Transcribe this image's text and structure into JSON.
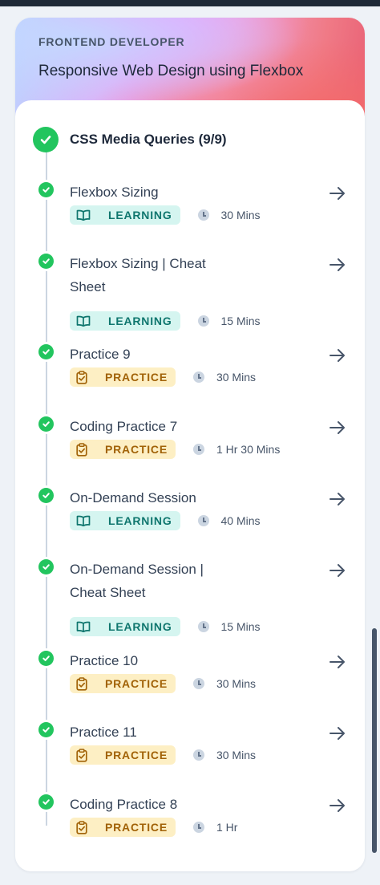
{
  "course": {
    "eyebrow": "FRONTEND DEVELOPER",
    "title": "Responsive Web Design using Flexbox"
  },
  "section": {
    "title": "CSS Media Queries (9/9)",
    "status": "completed"
  },
  "items": [
    {
      "title": "Flexbox Sizing",
      "type": "LEARNING",
      "duration": "30 Mins",
      "completed": true
    },
    {
      "title": "Flexbox Sizing | Cheat Sheet",
      "type": "LEARNING",
      "duration": "15 Mins",
      "completed": true
    },
    {
      "title": "Practice 9",
      "type": "PRACTICE",
      "duration": "30 Mins",
      "completed": true
    },
    {
      "title": "Coding Practice 7",
      "type": "PRACTICE",
      "duration": "1 Hr 30 Mins",
      "completed": true
    },
    {
      "title": "On-Demand Session",
      "type": "LEARNING",
      "duration": "40 Mins",
      "completed": true
    },
    {
      "title": "On-Demand Session | Cheat Sheet",
      "type": "LEARNING",
      "duration": "15 Mins",
      "completed": true
    },
    {
      "title": "Practice 10",
      "type": "PRACTICE",
      "duration": "30 Mins",
      "completed": true
    },
    {
      "title": "Practice 11",
      "type": "PRACTICE",
      "duration": "30 Mins",
      "completed": true
    },
    {
      "title": "Coding Practice 8",
      "type": "PRACTICE",
      "duration": "1 Hr",
      "completed": true
    }
  ],
  "icons": {
    "completed": "check-circle-icon",
    "open": "arrow-right-icon",
    "learning": "book-open-icon",
    "practice": "clipboard-check-icon",
    "duration": "clock-icon"
  },
  "colors": {
    "success": "#22c55e",
    "learning_bg": "#d5f5f0",
    "learning_text": "#0f766e",
    "practice_bg": "#fdefc4",
    "practice_text": "#a16207"
  }
}
